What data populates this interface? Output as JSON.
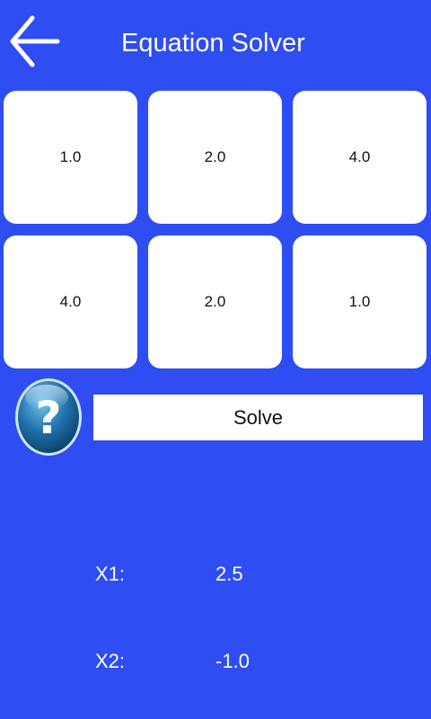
{
  "header": {
    "title": "Equation Solver",
    "back_icon": "arrow-left-icon"
  },
  "coefficients": {
    "row1": [
      "1.0",
      "2.0",
      "4.0"
    ],
    "row2": [
      "4.0",
      "2.0",
      "1.0"
    ]
  },
  "help": {
    "icon": "help-question-icon"
  },
  "solve": {
    "label": "Solve"
  },
  "results": {
    "x1_label": "X1:",
    "x1_value": "2.5",
    "x2_label": "X2:",
    "x2_value": "-1.0"
  },
  "colors": {
    "background": "#2e4df2",
    "cell": "#ffffff",
    "help_button": "#1f6fa8"
  }
}
